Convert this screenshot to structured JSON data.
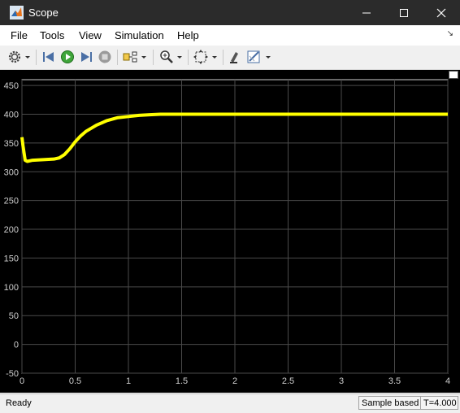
{
  "window": {
    "title": "Scope",
    "accent_color": "#2b2b2b"
  },
  "menu": {
    "items": [
      "File",
      "Tools",
      "View",
      "Simulation",
      "Help"
    ]
  },
  "toolbar": {
    "icons": [
      "settings-icon",
      "step-back-icon",
      "run-icon",
      "step-forward-icon",
      "stop-icon",
      "signal-selector-icon",
      "zoom-icon",
      "autoscale-icon",
      "highlight-icon",
      "style-icon"
    ]
  },
  "status": {
    "left": "Ready",
    "sample_mode": "Sample based",
    "time": "T=4.000"
  },
  "chart_data": {
    "type": "line",
    "title": "",
    "xlabel": "",
    "ylabel": "",
    "xlim": [
      0,
      4
    ],
    "ylim": [
      -50,
      460
    ],
    "xticks": [
      "0",
      "0.5",
      "1",
      "1.5",
      "2",
      "2.5",
      "3",
      "3.5",
      "4"
    ],
    "yticks": [
      "-50",
      "0",
      "50",
      "100",
      "150",
      "200",
      "250",
      "300",
      "350",
      "400",
      "450"
    ],
    "grid": true,
    "line_color": "#ffff00",
    "background": "#000000",
    "series": [
      {
        "x": [
          0,
          0.01,
          0.03,
          0.05,
          0.1,
          0.2,
          0.3,
          0.35,
          0.4,
          0.45,
          0.5,
          0.55,
          0.6,
          0.7,
          0.8,
          0.9,
          1.0,
          1.1,
          1.2,
          1.3,
          1.5,
          1.75,
          2.0,
          2.5,
          3.0,
          3.5,
          4.0
        ],
        "y": [
          360,
          345,
          320,
          318,
          320,
          321,
          322,
          324,
          330,
          340,
          352,
          362,
          370,
          381,
          389,
          394,
          396,
          398,
          399,
          400,
          400,
          400,
          400,
          400,
          400,
          400,
          400
        ]
      }
    ]
  }
}
